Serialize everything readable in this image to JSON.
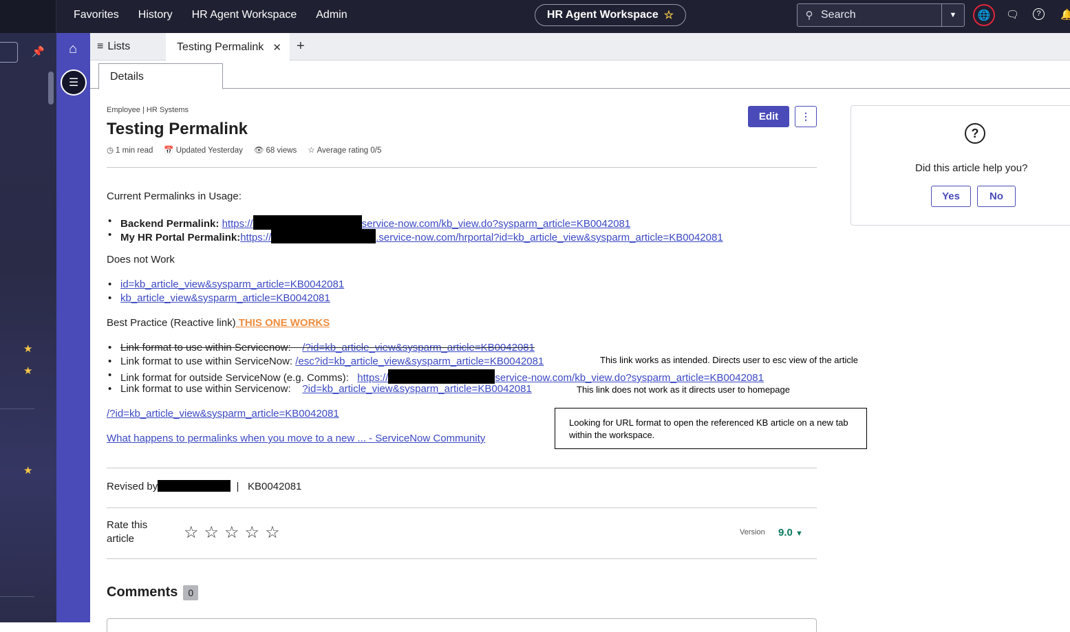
{
  "topnav": {
    "favorites": "Favorites",
    "history": "History",
    "hr_agent_workspace": "HR Agent Workspace",
    "admin": "Admin",
    "workspace_pill": "HR Agent Workspace",
    "search_placeholder": "Search"
  },
  "tabs": {
    "lists_label": "Lists",
    "active_tab": "Testing Permalink",
    "subtab_details": "Details"
  },
  "article": {
    "breadcrumb": "Employee | HR Systems",
    "title": "Testing Permalink",
    "meta_read": "1 min read",
    "meta_updated": "Updated Yesterday",
    "meta_views": "68 views",
    "meta_rating": "Average rating 0/5",
    "edit_label": "Edit",
    "current_permalinks_heading": "Current Permalinks in Usage:",
    "backend_label": "Backend Permalink:",
    "backend_link_prefix": "https://",
    "backend_link_suffix": "service-now.com/kb_view.do?sysparm_article=KB0042081",
    "myhr_label": "My HR Portal Permalink:",
    "myhr_link_prefix": "https://",
    "myhr_link_suffix": ".service-now.com/hrportal?id=kb_article_view&sysparm_article=KB0042081",
    "does_not_work": "Does not Work",
    "dnw_link_1": "id=kb_article_view&sysparm_article=KB0042081",
    "dnw_link_2": "kb_article_view&sysparm_article=KB0042081",
    "best_practice": "Best Practice (Reactive link)",
    "this_one_works": " THIS ONE WORKS",
    "bp1_label": "Link format to use within Servicenow:",
    "bp1_link": "/?id=kb_article_view&sysparm_article=KB0042081",
    "bp2_label": "Link format to use within ServiceNow:",
    "bp2_link": "/esc?id=kb_article_view&sysparm_article=KB0042081",
    "bp2_note": "This link works as intended.  Directs user to esc view of the article",
    "bp3_label": "Link format for outside ServiceNow (e.g. Comms):",
    "bp3_link_prefix": "https://",
    "bp3_link_suffix": "service-now.com/kb_view.do?sysparm_article=KB0042081",
    "bp4_label": "Link format to use within Servicenow:",
    "bp4_link": "?id=kb_article_view&sysparm_article=KB0042081",
    "bp4_note": "This link does not work as it directs user to homepage",
    "standalone_link": "/?id=kb_article_view&sysparm_article=KB0042081",
    "community_link": "What happens to permalinks when you move to a new ... - ServiceNow Community",
    "callout": "Looking for URL format to open the referenced KB article on a new tab within the workspace.",
    "revised_by": "Revised by",
    "separator": "|",
    "kb_number": "KB0042081",
    "rate_label": "Rate this article",
    "version_label": "Version",
    "version_value": "9.0",
    "comments_label": "Comments",
    "comments_count": "0",
    "rating_value": 0
  },
  "helpcard": {
    "question": "Did this article help you?",
    "yes": "Yes",
    "no": "No"
  },
  "colors": {
    "accent": "#4a4bb8",
    "topbar": "#1f2031",
    "link": "#3b49c3",
    "orange": "#ef8c3d",
    "version_green": "#0a7a5f",
    "favorite_star": "#f7c948"
  }
}
